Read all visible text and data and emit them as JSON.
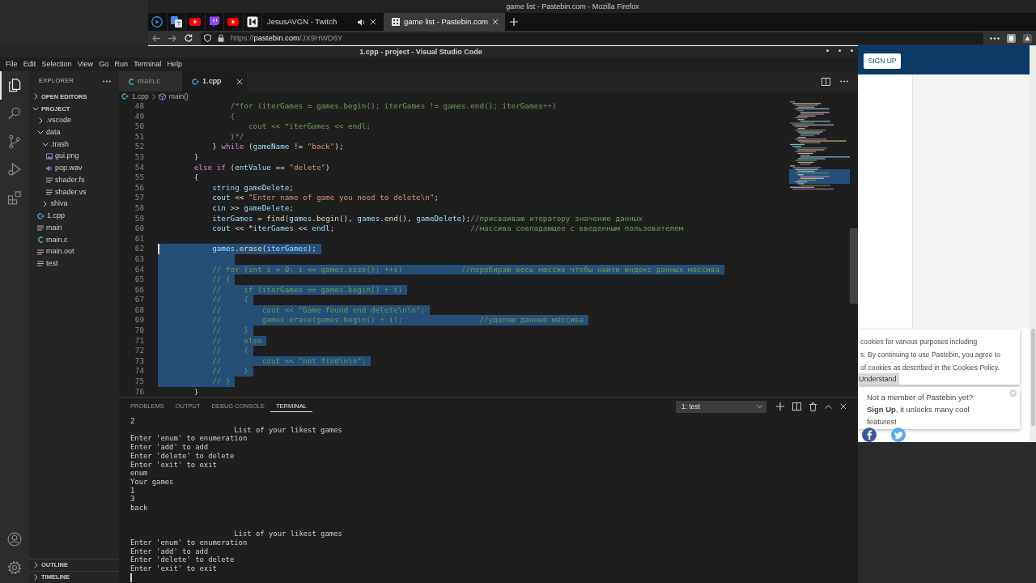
{
  "browser": {
    "title": "game list - Pastebin.com - Mozilla Firefox",
    "tabs": [
      {
        "label": "JesusAVGN - Twitch",
        "selected": false,
        "playing": true,
        "icon": false
      },
      {
        "label": "game list - Pastebin.com",
        "selected": true,
        "playing": false,
        "icon": true
      }
    ],
    "url": {
      "scheme": "https://",
      "host": "pastebin.com",
      "path": "/JX9HWD6Y"
    },
    "page": {
      "signup_button": "SIGN UP",
      "cookie_notice": {
        "lines": [
          "cookies for various purposes including",
          "s. By continuing to use Pastebin, you agree to"
        ],
        "last_line": "of cookies as described in the",
        "policy_link": "Cookies Policy.",
        "button": "Understand"
      },
      "member_prompt": {
        "question": "Not a member of Pastebin yet?",
        "link": "Sign Up",
        "text": ", it unlocks many cool features!"
      }
    }
  },
  "vscode": {
    "title": "1.cpp - project - Visual Studio Code",
    "menu": [
      "File",
      "Edit",
      "Selection",
      "View",
      "Go",
      "Run",
      "Terminal",
      "Help"
    ],
    "activity_bar": [
      {
        "selected": true
      },
      {
        "selected": false
      },
      {
        "selected": false
      },
      {
        "selected": false
      },
      {
        "selected": false
      }
    ],
    "explorer": {
      "title": "EXPLORER",
      "sections": [
        {
          "label": "OPEN EDITORS",
          "expanded": false
        },
        {
          "label": "PROJECT",
          "expanded": true,
          "children": [
            {
              "label": ".vscode",
              "kind": "folder",
              "expanded": false
            },
            {
              "label": "data",
              "kind": "folder",
              "expanded": true,
              "children": [
                {
                  "label": ".trash",
                  "kind": "folder",
                  "expanded": true,
                  "children": [
                    {
                      "label": "gui.png",
                      "kind": "image"
                    },
                    {
                      "label": "pop.wav",
                      "kind": "audio"
                    },
                    {
                      "label": "shader.fs",
                      "kind": "text"
                    },
                    {
                      "label": "shader.vs",
                      "kind": "text"
                    }
                  ]
                },
                {
                  "label": "shiva",
                  "kind": "folder",
                  "expanded": false
                }
              ]
            },
            {
              "label": "1.cpp",
              "kind": "cpp"
            },
            {
              "label": "main",
              "kind": "text"
            },
            {
              "label": "main.c",
              "kind": "c"
            },
            {
              "label": "main.out",
              "kind": "text"
            },
            {
              "label": "test",
              "kind": "text"
            }
          ]
        }
      ],
      "bottom_sections": [
        {
          "label": "OUTLINE",
          "expanded": false
        },
        {
          "label": "TIMELINE",
          "expanded": false
        }
      ]
    },
    "tabs": [
      {
        "label": "main.c",
        "kind": "c",
        "selected": false
      },
      {
        "label": "1.cpp",
        "kind": "cpp",
        "selected": true
      }
    ],
    "breadcrumb": [
      {
        "label": "1.cpp",
        "kind": "cpp"
      },
      {
        "label": "main()",
        "kind": "function"
      }
    ],
    "code": [
      {
        "number": "48",
        "selected": false,
        "cursor": false,
        "tokens": [
          {
            "kind": "comment",
            "text": "                /*for (iterGames = games.begin(); iterGames != games.end(); iterGames++)"
          }
        ]
      },
      {
        "number": "49",
        "selected": false,
        "cursor": false,
        "tokens": [
          {
            "kind": "comment",
            "text": "                {"
          }
        ]
      },
      {
        "number": "50",
        "selected": false,
        "cursor": false,
        "tokens": [
          {
            "kind": "comment",
            "text": "                    cout << *iterGames << endl;"
          }
        ]
      },
      {
        "number": "51",
        "selected": false,
        "cursor": false,
        "tokens": [
          {
            "kind": "comment",
            "text": "                }*/"
          }
        ]
      },
      {
        "number": "52",
        "selected": false,
        "cursor": false,
        "tokens": [
          {
            "kind": "plain",
            "text": "            } "
          },
          {
            "kind": "keyword",
            "text": "while"
          },
          {
            "kind": "plain",
            "text": " ("
          },
          {
            "kind": "variable",
            "text": "gameName"
          },
          {
            "kind": "plain",
            "text": " != "
          },
          {
            "kind": "string",
            "text": "\"back\""
          },
          {
            "kind": "plain",
            "text": ");"
          }
        ]
      },
      {
        "number": "53",
        "selected": false,
        "cursor": false,
        "tokens": [
          {
            "kind": "plain",
            "text": "        }"
          }
        ]
      },
      {
        "number": "54",
        "selected": false,
        "cursor": false,
        "tokens": [
          {
            "kind": "keyword",
            "text": "        else if"
          },
          {
            "kind": "plain",
            "text": " ("
          },
          {
            "kind": "variable",
            "text": "entValue"
          },
          {
            "kind": "plain",
            "text": " == "
          },
          {
            "kind": "string",
            "text": "\"delete\""
          },
          {
            "kind": "plain",
            "text": ")"
          }
        ]
      },
      {
        "number": "55",
        "selected": false,
        "cursor": false,
        "tokens": [
          {
            "kind": "plain",
            "text": "        {"
          }
        ]
      },
      {
        "number": "56",
        "selected": false,
        "cursor": false,
        "tokens": [
          {
            "kind": "type",
            "text": "            string"
          },
          {
            "kind": "variable",
            "text": " gameDelete"
          },
          {
            "kind": "plain",
            "text": ";"
          }
        ]
      },
      {
        "number": "57",
        "selected": false,
        "cursor": false,
        "tokens": [
          {
            "kind": "variable",
            "text": "            cout"
          },
          {
            "kind": "plain",
            "text": " << "
          },
          {
            "kind": "string",
            "text": "\"Enter name of game you need to delete\\n\""
          },
          {
            "kind": "plain",
            "text": ";"
          }
        ]
      },
      {
        "number": "58",
        "selected": false,
        "cursor": false,
        "tokens": [
          {
            "kind": "variable",
            "text": "            cin"
          },
          {
            "kind": "plain",
            "text": " >> "
          },
          {
            "kind": "variable",
            "text": "gameDelete"
          },
          {
            "kind": "plain",
            "text": ";"
          }
        ]
      },
      {
        "number": "59",
        "selected": false,
        "cursor": false,
        "tokens": [
          {
            "kind": "variable",
            "text": "            iterGames"
          },
          {
            "kind": "plain",
            "text": " = "
          },
          {
            "kind": "function",
            "text": "find"
          },
          {
            "kind": "plain",
            "text": "("
          },
          {
            "kind": "variable",
            "text": "games"
          },
          {
            "kind": "plain",
            "text": "."
          },
          {
            "kind": "function",
            "text": "begin"
          },
          {
            "kind": "plain",
            "text": "(), "
          },
          {
            "kind": "variable",
            "text": "games"
          },
          {
            "kind": "plain",
            "text": "."
          },
          {
            "kind": "function",
            "text": "end"
          },
          {
            "kind": "plain",
            "text": "(), "
          },
          {
            "kind": "variable",
            "text": "gameDelete"
          },
          {
            "kind": "plain",
            "text": ");"
          },
          {
            "kind": "comment",
            "text": "//присваиваю итератору значение данных"
          }
        ]
      },
      {
        "number": "60",
        "selected": false,
        "cursor": false,
        "tokens": [
          {
            "kind": "variable",
            "text": "            cout"
          },
          {
            "kind": "plain",
            "text": " << *"
          },
          {
            "kind": "variable",
            "text": "iterGames"
          },
          {
            "kind": "plain",
            "text": " << "
          },
          {
            "kind": "variable",
            "text": "endl"
          },
          {
            "kind": "plain",
            "text": ";"
          },
          {
            "kind": "comment",
            "text": "                              //массива совпадающее с введенным пользователем"
          }
        ]
      },
      {
        "number": "61",
        "selected": false,
        "cursor": false
      },
      {
        "number": "62",
        "selected": true,
        "cursor": true,
        "tokens": [
          {
            "kind": "variable",
            "text": "            games"
          },
          {
            "kind": "plain",
            "text": "."
          },
          {
            "kind": "function",
            "text": "erase"
          },
          {
            "kind": "plain",
            "text": "("
          },
          {
            "kind": "variable",
            "text": "iterGames"
          },
          {
            "kind": "plain",
            "text": ");"
          }
        ]
      },
      {
        "number": "63",
        "selected": true,
        "cursor": false
      },
      {
        "number": "64",
        "selected": true,
        "cursor": false,
        "tokens": [
          {
            "kind": "comment",
            "text": "            // for (int i = 0; i <= games.size(); ++i)             //перебираю весь массив чтобы найти индекс данных массива"
          }
        ]
      },
      {
        "number": "65",
        "selected": true,
        "cursor": false,
        "tokens": [
          {
            "kind": "comment",
            "text": "            // {"
          }
        ]
      },
      {
        "number": "66",
        "selected": true,
        "cursor": false,
        "tokens": [
          {
            "kind": "comment",
            "text": "            //     if (iterGames == games.begin() + i)"
          }
        ]
      },
      {
        "number": "67",
        "selected": true,
        "cursor": false,
        "tokens": [
          {
            "kind": "comment",
            "text": "            //     {"
          }
        ]
      },
      {
        "number": "68",
        "selected": true,
        "cursor": false,
        "tokens": [
          {
            "kind": "comment",
            "text": "            //         cout << \"Game found end delete\\n\\n\";"
          }
        ]
      },
      {
        "number": "69",
        "selected": true,
        "cursor": false,
        "tokens": [
          {
            "kind": "comment",
            "text": "            //         games.erase(games.begin() + i);                 //удаляю данные массива"
          }
        ]
      },
      {
        "number": "70",
        "selected": true,
        "cursor": false,
        "tokens": [
          {
            "kind": "comment",
            "text": "            //     }"
          }
        ]
      },
      {
        "number": "71",
        "selected": true,
        "cursor": false,
        "tokens": [
          {
            "kind": "comment",
            "text": "            //     else"
          }
        ]
      },
      {
        "number": "72",
        "selected": true,
        "cursor": false,
        "tokens": [
          {
            "kind": "comment",
            "text": "            //     {"
          }
        ]
      },
      {
        "number": "73",
        "selected": true,
        "cursor": false,
        "tokens": [
          {
            "kind": "comment",
            "text": "            //         cout << \"not find\\n\\n\";"
          }
        ]
      },
      {
        "number": "74",
        "selected": true,
        "cursor": false,
        "tokens": [
          {
            "kind": "comment",
            "text": "            //     }"
          }
        ]
      },
      {
        "number": "75",
        "selected": true,
        "cursor": false,
        "tokens": [
          {
            "kind": "comment",
            "text": "            // }"
          }
        ]
      },
      {
        "number": "76",
        "selected": false,
        "cursor": false,
        "tokens": [
          {
            "kind": "plain",
            "text": "        }"
          }
        ]
      }
    ],
    "panel": {
      "tabs": [
        {
          "label": "PROBLEMS",
          "selected": false
        },
        {
          "label": "OUTPUT",
          "selected": false
        },
        {
          "label": "DEBUG CONSOLE",
          "selected": false
        },
        {
          "label": "TERMINAL",
          "selected": true
        }
      ],
      "terminal": "1: test",
      "output": "2\n\t\t\tList of your likest games\nEnter 'enum' to enumeration\nEnter 'add' to add\nEnter 'delete' to delete\nEnter 'exit' to exit\nenum\nYour games\n1\n3\nback\n\n\n\t\t\tList of your likest games\nEnter 'enum' to enumeration\nEnter 'add' to add\nEnter 'delete' to delete\nEnter 'exit' to exit"
    }
  }
}
